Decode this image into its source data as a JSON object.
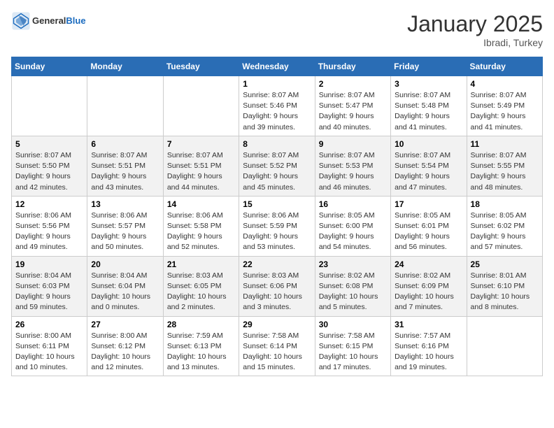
{
  "header": {
    "logo_general": "General",
    "logo_blue": "Blue",
    "month": "January 2025",
    "location": "Ibradi, Turkey"
  },
  "days_of_week": [
    "Sunday",
    "Monday",
    "Tuesday",
    "Wednesday",
    "Thursday",
    "Friday",
    "Saturday"
  ],
  "weeks": [
    [
      {
        "num": "",
        "info": ""
      },
      {
        "num": "",
        "info": ""
      },
      {
        "num": "",
        "info": ""
      },
      {
        "num": "1",
        "info": "Sunrise: 8:07 AM\nSunset: 5:46 PM\nDaylight: 9 hours\nand 39 minutes."
      },
      {
        "num": "2",
        "info": "Sunrise: 8:07 AM\nSunset: 5:47 PM\nDaylight: 9 hours\nand 40 minutes."
      },
      {
        "num": "3",
        "info": "Sunrise: 8:07 AM\nSunset: 5:48 PM\nDaylight: 9 hours\nand 41 minutes."
      },
      {
        "num": "4",
        "info": "Sunrise: 8:07 AM\nSunset: 5:49 PM\nDaylight: 9 hours\nand 41 minutes."
      }
    ],
    [
      {
        "num": "5",
        "info": "Sunrise: 8:07 AM\nSunset: 5:50 PM\nDaylight: 9 hours\nand 42 minutes."
      },
      {
        "num": "6",
        "info": "Sunrise: 8:07 AM\nSunset: 5:51 PM\nDaylight: 9 hours\nand 43 minutes."
      },
      {
        "num": "7",
        "info": "Sunrise: 8:07 AM\nSunset: 5:51 PM\nDaylight: 9 hours\nand 44 minutes."
      },
      {
        "num": "8",
        "info": "Sunrise: 8:07 AM\nSunset: 5:52 PM\nDaylight: 9 hours\nand 45 minutes."
      },
      {
        "num": "9",
        "info": "Sunrise: 8:07 AM\nSunset: 5:53 PM\nDaylight: 9 hours\nand 46 minutes."
      },
      {
        "num": "10",
        "info": "Sunrise: 8:07 AM\nSunset: 5:54 PM\nDaylight: 9 hours\nand 47 minutes."
      },
      {
        "num": "11",
        "info": "Sunrise: 8:07 AM\nSunset: 5:55 PM\nDaylight: 9 hours\nand 48 minutes."
      }
    ],
    [
      {
        "num": "12",
        "info": "Sunrise: 8:06 AM\nSunset: 5:56 PM\nDaylight: 9 hours\nand 49 minutes."
      },
      {
        "num": "13",
        "info": "Sunrise: 8:06 AM\nSunset: 5:57 PM\nDaylight: 9 hours\nand 50 minutes."
      },
      {
        "num": "14",
        "info": "Sunrise: 8:06 AM\nSunset: 5:58 PM\nDaylight: 9 hours\nand 52 minutes."
      },
      {
        "num": "15",
        "info": "Sunrise: 8:06 AM\nSunset: 5:59 PM\nDaylight: 9 hours\nand 53 minutes."
      },
      {
        "num": "16",
        "info": "Sunrise: 8:05 AM\nSunset: 6:00 PM\nDaylight: 9 hours\nand 54 minutes."
      },
      {
        "num": "17",
        "info": "Sunrise: 8:05 AM\nSunset: 6:01 PM\nDaylight: 9 hours\nand 56 minutes."
      },
      {
        "num": "18",
        "info": "Sunrise: 8:05 AM\nSunset: 6:02 PM\nDaylight: 9 hours\nand 57 minutes."
      }
    ],
    [
      {
        "num": "19",
        "info": "Sunrise: 8:04 AM\nSunset: 6:03 PM\nDaylight: 9 hours\nand 59 minutes."
      },
      {
        "num": "20",
        "info": "Sunrise: 8:04 AM\nSunset: 6:04 PM\nDaylight: 10 hours\nand 0 minutes."
      },
      {
        "num": "21",
        "info": "Sunrise: 8:03 AM\nSunset: 6:05 PM\nDaylight: 10 hours\nand 2 minutes."
      },
      {
        "num": "22",
        "info": "Sunrise: 8:03 AM\nSunset: 6:06 PM\nDaylight: 10 hours\nand 3 minutes."
      },
      {
        "num": "23",
        "info": "Sunrise: 8:02 AM\nSunset: 6:08 PM\nDaylight: 10 hours\nand 5 minutes."
      },
      {
        "num": "24",
        "info": "Sunrise: 8:02 AM\nSunset: 6:09 PM\nDaylight: 10 hours\nand 7 minutes."
      },
      {
        "num": "25",
        "info": "Sunrise: 8:01 AM\nSunset: 6:10 PM\nDaylight: 10 hours\nand 8 minutes."
      }
    ],
    [
      {
        "num": "26",
        "info": "Sunrise: 8:00 AM\nSunset: 6:11 PM\nDaylight: 10 hours\nand 10 minutes."
      },
      {
        "num": "27",
        "info": "Sunrise: 8:00 AM\nSunset: 6:12 PM\nDaylight: 10 hours\nand 12 minutes."
      },
      {
        "num": "28",
        "info": "Sunrise: 7:59 AM\nSunset: 6:13 PM\nDaylight: 10 hours\nand 13 minutes."
      },
      {
        "num": "29",
        "info": "Sunrise: 7:58 AM\nSunset: 6:14 PM\nDaylight: 10 hours\nand 15 minutes."
      },
      {
        "num": "30",
        "info": "Sunrise: 7:58 AM\nSunset: 6:15 PM\nDaylight: 10 hours\nand 17 minutes."
      },
      {
        "num": "31",
        "info": "Sunrise: 7:57 AM\nSunset: 6:16 PM\nDaylight: 10 hours\nand 19 minutes."
      },
      {
        "num": "",
        "info": ""
      }
    ]
  ]
}
